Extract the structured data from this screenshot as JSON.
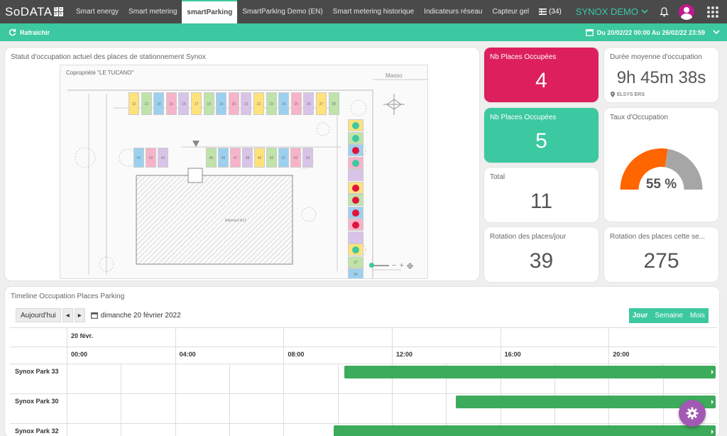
{
  "brand": {
    "logo_text": "SoDATA",
    "logo_letters": [
      "S",
      "o",
      "D",
      "A"
    ]
  },
  "nav": {
    "tabs": [
      {
        "label": "Smart energy",
        "active": false
      },
      {
        "label": "Smart metering",
        "active": false
      },
      {
        "label": "smartParking",
        "active": true
      },
      {
        "label": "SmartParking Demo (EN)",
        "active": false
      },
      {
        "label": "Smart metering historique",
        "active": false
      },
      {
        "label": "Indicateurs réseau",
        "active": false
      },
      {
        "label": "Capteur gel",
        "active": false
      }
    ],
    "add_tab": "+",
    "list_count": "(34)",
    "org": "SYNOX DEMO"
  },
  "toolbar": {
    "refresh_label": "Rafraîchir",
    "date_range": "Du 20/02/22 00:00 Au 26/02/22 23:59"
  },
  "map_card": {
    "title": "Statut d'occupation actuel des places de stationnement Synox",
    "plan_label": "Copropriété \"LE TUCANO\"",
    "building_label": "Bâtiment B12",
    "corner_label": "Masso",
    "top_slots": [
      "12",
      "13",
      "14",
      "15",
      "16",
      "17",
      "18",
      "19",
      "20",
      "21",
      "22",
      "23",
      "24",
      "25",
      "26",
      "27",
      "28"
    ],
    "mid_slots_left": [
      "41",
      "42",
      "43"
    ],
    "mid_slots_right": [
      "45",
      "46",
      "47",
      "48",
      "49",
      "50",
      "51",
      "52",
      "53"
    ],
    "side_slots": [
      "37",
      "36"
    ],
    "zoom_controls": [
      "−",
      "+"
    ]
  },
  "kpis": {
    "occupied_1": {
      "title": "Nb Places Occupées",
      "value": "4"
    },
    "avg_duration": {
      "title": "Durée moyenne d'occupation",
      "value": "9h 45m 38s",
      "sub": "ELSYS ERS"
    },
    "occupied_2": {
      "title": "Nb Places Occupées",
      "value": "5"
    },
    "rate": {
      "title": "Taux d'Occupation",
      "value": "55 %",
      "percent": 55
    },
    "total": {
      "title": "Total",
      "value": "11"
    },
    "rotation_day": {
      "title": "Rotation des places/jour",
      "value": "39"
    },
    "rotation_week": {
      "title": "Rotation des places cette se...",
      "value": "275"
    }
  },
  "timeline": {
    "title": "Timeline Occupation Places Parking",
    "today_btn": "Aujourd'hui",
    "prev": "◂",
    "next": "▸",
    "date_label": "dimanche 20 février 2022",
    "views": [
      "Jour",
      "Semaine",
      "Mois"
    ],
    "day_header": "20 févr.",
    "hours": [
      "00:00",
      "04:00",
      "08:00",
      "12:00",
      "16:00",
      "20:00"
    ],
    "rows": [
      {
        "name": "Synox Park 33",
        "start_hour": 10.25
      },
      {
        "name": "Synox Park 30",
        "start_hour": 14.35
      },
      {
        "name": "Synox Park 32",
        "start_hour": 9.85
      }
    ]
  },
  "colors": {
    "accent": "#3cc8a0",
    "pink": "#dd1f5d",
    "gauge_orange": "#ff6600",
    "gauge_grey": "#a6a6a6",
    "bar_green": "#3dab5c"
  }
}
